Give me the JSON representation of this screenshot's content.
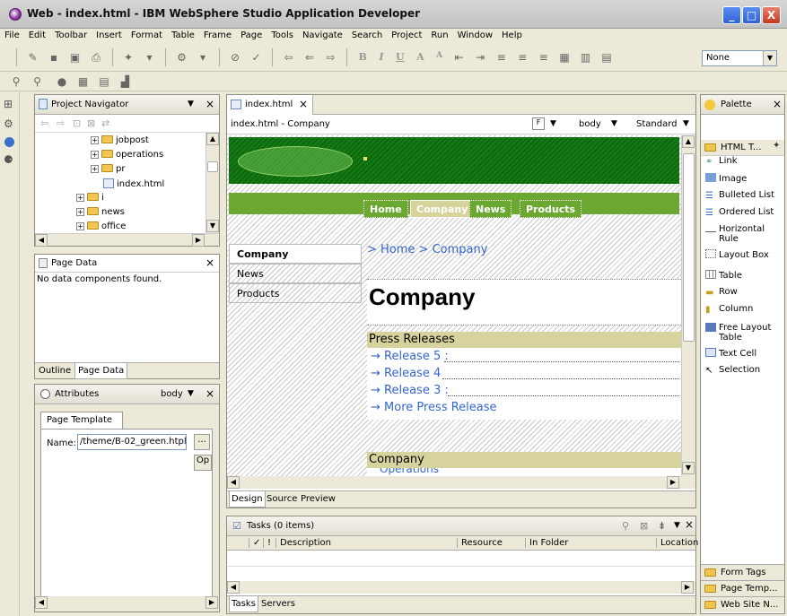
{
  "window": {
    "title": "Web - index.html - IBM WebSphere Studio Application Developer",
    "min": "_",
    "max": "□",
    "close": "X"
  },
  "menu": [
    "File",
    "Edit",
    "Toolbar",
    "Insert",
    "Format",
    "Table",
    "Frame",
    "Page",
    "Tools",
    "Navigate",
    "Search",
    "Project",
    "Run",
    "Window",
    "Help"
  ],
  "toolbar": {
    "style_combo": "None",
    "format_letters": [
      "B",
      "I",
      "U",
      "A",
      "A"
    ]
  },
  "project_navigator": {
    "title": "Project Navigator",
    "tree": [
      {
        "label": "jobpost",
        "indent": 2
      },
      {
        "label": "operations",
        "indent": 2
      },
      {
        "label": "pr",
        "indent": 2
      },
      {
        "label": "index.html",
        "indent": 3
      },
      {
        "label": "i",
        "indent": 1
      },
      {
        "label": "news",
        "indent": 1
      },
      {
        "label": "office",
        "indent": 1
      }
    ]
  },
  "page_data": {
    "title": "Page Data",
    "message": "No data components found.",
    "tabs": [
      "Outline",
      "Page Data"
    ]
  },
  "attributes": {
    "title": "Attributes",
    "scope": "body",
    "tab": "Page Template",
    "name_label": "Name:",
    "name_value": "/theme/B-02_green.htpl",
    "browse": "...",
    "open": "Op"
  },
  "editor": {
    "tab": "index.html",
    "path": "index.html - Company",
    "tag_combo": "body",
    "mode_combo": "Standard",
    "nav": [
      "Home",
      "Company",
      "News",
      "Products"
    ],
    "sidenav": [
      "Company",
      "News",
      "Products"
    ],
    "breadcrumb": "> Home > Company",
    "heading": "Company",
    "press_header": "Press Releases",
    "releases": [
      "Release 5 :",
      "Release 4",
      "Release 3 :",
      "More Press Release"
    ],
    "company_header": "Company",
    "operations_partial": "Operations",
    "bottom_tabs": [
      "Design",
      "Source",
      "Preview"
    ]
  },
  "palette": {
    "title": "Palette",
    "drawer": "HTML T...",
    "items": [
      "Link",
      "Image",
      "Bulleted List",
      "Ordered List",
      "Horizontal Rule",
      "Layout Box",
      "Table",
      "Row",
      "Column",
      "Free Layout Table",
      "Text Cell",
      "Selection"
    ],
    "bottom_drawers": [
      "Form Tags",
      "Page Temp...",
      "Web Site N..."
    ]
  },
  "tasks": {
    "title": "Tasks (0 items)",
    "columns": [
      "✓",
      "!",
      "Description",
      "Resource",
      "In Folder",
      "Location"
    ],
    "bottom_tabs": [
      "Tasks",
      "Servers"
    ]
  },
  "colors": {
    "green": "#137a13",
    "nav_green": "#6aa832",
    "section_bg": "#d7d39c",
    "link": "#3366cc"
  }
}
